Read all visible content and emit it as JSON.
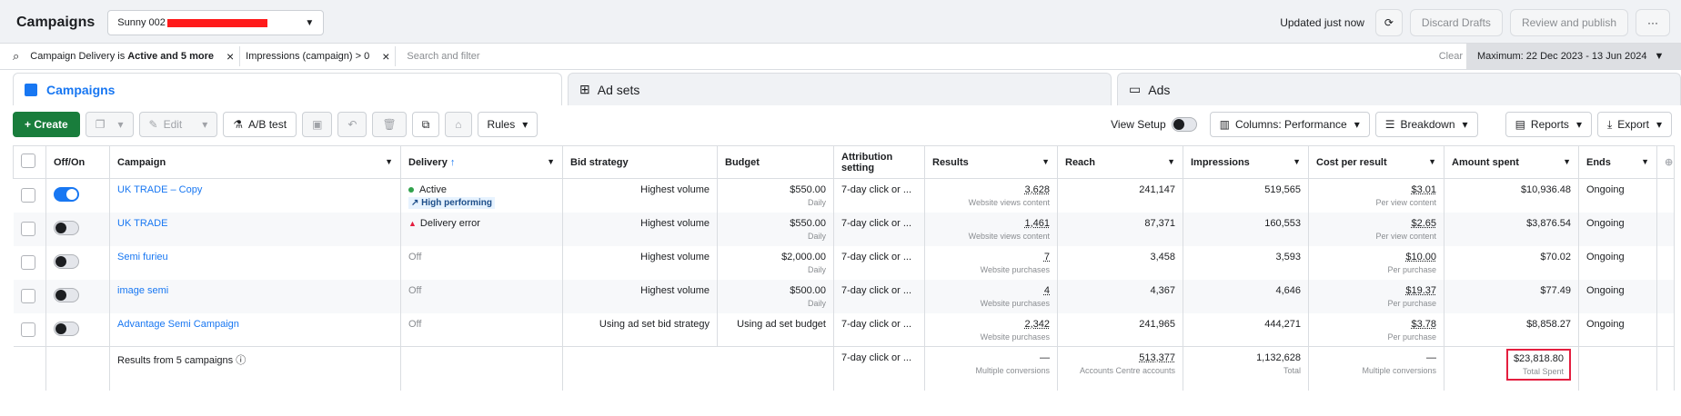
{
  "header": {
    "title": "Campaigns",
    "account": "Sunny 002",
    "updated": "Updated just now",
    "discard": "Discard Drafts",
    "review": "Review and publish",
    "more": "···"
  },
  "filters": {
    "chip1_prefix": "Campaign Delivery is",
    "chip1_bold": "Active and 5 more",
    "chip2": "Impressions (campaign) > 0",
    "search_placeholder": "Search and filter",
    "clear": "Clear",
    "date": "Maximum: 22 Dec 2023 - 13 Jun 2024"
  },
  "tabs": {
    "campaigns": "Campaigns",
    "adsets": "Ad sets",
    "ads": "Ads"
  },
  "toolbar": {
    "create": "+ Create",
    "edit": "Edit",
    "ab": "A/B test",
    "rules": "Rules",
    "view_setup": "View Setup",
    "columns": "Columns: Performance",
    "breakdown": "Breakdown",
    "reports": "Reports",
    "export": "Export"
  },
  "columns": [
    "Off/On",
    "Campaign",
    "Delivery",
    "Bid strategy",
    "Budget",
    "Attribution setting",
    "Results",
    "Reach",
    "Impressions",
    "Cost per result",
    "Amount spent",
    "Ends"
  ],
  "rows": [
    {
      "name": "UK TRADE – Copy",
      "delivery": "Active",
      "badge": "High performing",
      "bid": "Highest volume",
      "budget": "$550.00",
      "budget_sub": "Daily",
      "attr": "7-day click or ...",
      "results": "3,628",
      "results_sub": "Website views content",
      "reach": "241,147",
      "impr": "519,565",
      "cpr": "$3.01",
      "cpr_sub": "Per view content",
      "spent": "$10,936.48",
      "ends": "Ongoing"
    },
    {
      "name": "UK TRADE",
      "delivery": "Delivery error",
      "bid": "Highest volume",
      "budget": "$550.00",
      "budget_sub": "Daily",
      "attr": "7-day click or ...",
      "results": "1,461",
      "results_sub": "Website views content",
      "reach": "87,371",
      "impr": "160,553",
      "cpr": "$2.65",
      "cpr_sub": "Per view content",
      "spent": "$3,876.54",
      "ends": "Ongoing"
    },
    {
      "name": "Semi furieu",
      "delivery": "Off",
      "bid": "Highest volume",
      "budget": "$2,000.00",
      "budget_sub": "Daily",
      "attr": "7-day click or ...",
      "results": "7",
      "results_sub": "Website purchases",
      "reach": "3,458",
      "impr": "3,593",
      "cpr": "$10.00",
      "cpr_sub": "Per purchase",
      "spent": "$70.02",
      "ends": "Ongoing"
    },
    {
      "name": "image semi",
      "delivery": "Off",
      "bid": "Highest volume",
      "budget": "$500.00",
      "budget_sub": "Daily",
      "attr": "7-day click or ...",
      "results": "4",
      "results_sub": "Website purchases",
      "reach": "4,367",
      "impr": "4,646",
      "cpr": "$19.37",
      "cpr_sub": "Per purchase",
      "spent": "$77.49",
      "ends": "Ongoing"
    },
    {
      "name": "Advantage Semi Campaign",
      "delivery": "Off",
      "bid": "Using ad set bid strategy",
      "budget": "Using ad set budget",
      "attr": "7-day click or ...",
      "results": "2,342",
      "results_sub": "Website purchases",
      "reach": "241,965",
      "impr": "444,271",
      "cpr": "$3.78",
      "cpr_sub": "Per purchase",
      "spent": "$8,858.27",
      "ends": "Ongoing"
    }
  ],
  "totals": {
    "label": "Results from 5 campaigns",
    "attr": "7-day click or ...",
    "results": "—",
    "results_sub": "Multiple conversions",
    "reach": "513,377",
    "reach_sub": "Accounts Centre accounts",
    "impr": "1,132,628",
    "impr_sub": "Total",
    "cpr": "—",
    "cpr_sub": "Multiple conversions",
    "spent": "$23,818.80",
    "spent_sub": "Total Spent"
  }
}
